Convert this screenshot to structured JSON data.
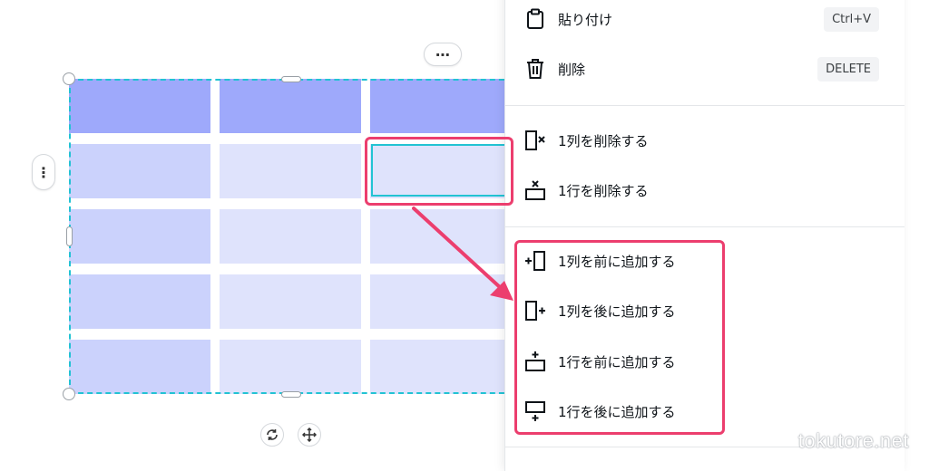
{
  "toolbar": {
    "more_label": "⋯",
    "side_more_label": "⋮"
  },
  "table": {
    "rows": 5,
    "cols": 3,
    "header_color": "#9ea9fb",
    "first_col_color": "#cbd2fc",
    "cell_color": "#dfe3fc",
    "selection_color": "#22c3d3"
  },
  "menu": {
    "paste": {
      "label": "貼り付け",
      "shortcut": "Ctrl+V",
      "icon": "clipboard-icon"
    },
    "delete": {
      "label": "削除",
      "shortcut": "DELETE",
      "icon": "trash-icon"
    },
    "delete_column": {
      "label": "1列を削除する",
      "icon": "delete-column-icon"
    },
    "delete_row": {
      "label": "1行を削除する",
      "icon": "delete-row-icon"
    },
    "add_column_before": {
      "label": "1列を前に追加する",
      "icon": "add-column-before-icon"
    },
    "add_column_after": {
      "label": "1列を後に追加する",
      "icon": "add-column-after-icon"
    },
    "add_row_before": {
      "label": "1行を前に追加する",
      "icon": "add-row-before-icon"
    },
    "add_row_after": {
      "label": "1行を後に追加する",
      "icon": "add-row-after-icon"
    }
  },
  "annotation": {
    "color": "#ec3e6e"
  },
  "watermark": "tokutore.net"
}
